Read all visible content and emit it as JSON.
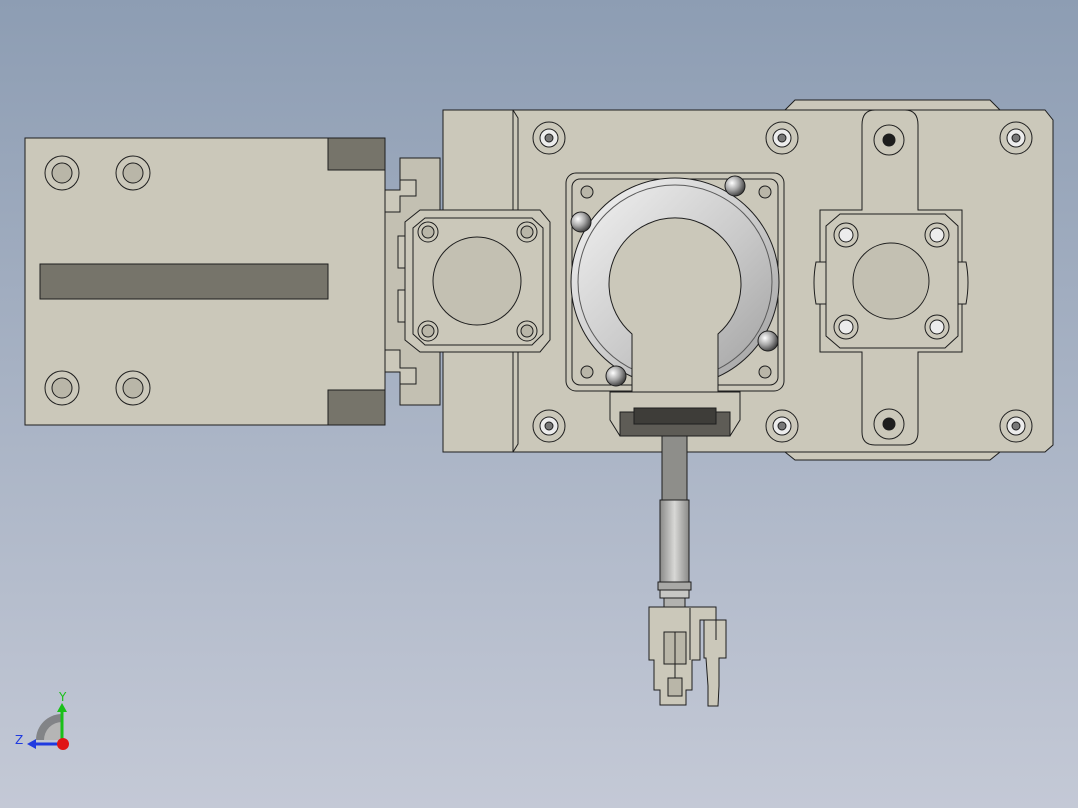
{
  "viewport": {
    "background_top": "#8D9DB3",
    "background_bottom": "#C4C9D6"
  },
  "part_colors": {
    "body": "#CBC8BA",
    "body_dark": "#B9B6A8",
    "slot": "#76746A",
    "edge": "#1E1E1E",
    "metal_light": "#ECECEC",
    "metal_mid": "#B8B8B8",
    "cable": "#8E8E8A"
  },
  "triad": {
    "y_label": "Y",
    "z_label": "Z",
    "y_color": "#19C019",
    "z_color": "#1F3AE0",
    "x_color": "#E01515"
  }
}
